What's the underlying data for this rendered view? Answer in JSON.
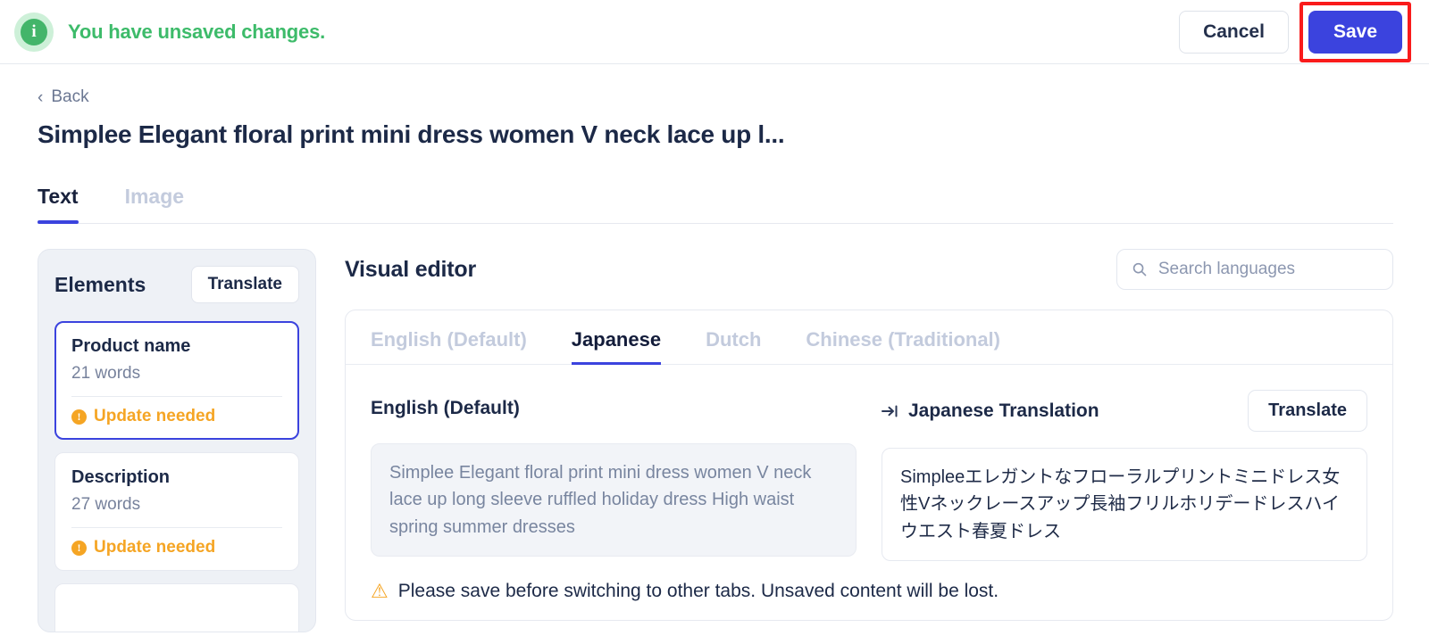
{
  "topbar": {
    "info_icon": "info-circle-icon",
    "message": "You have unsaved changes.",
    "cancel_label": "Cancel",
    "save_label": "Save",
    "save_button_color": "#3b43de",
    "message_color": "#3dbb6a",
    "highlight_color": "#f91b1b"
  },
  "page": {
    "back_label": "Back",
    "back_chevron": "‹",
    "title": "Simplee Elegant floral print mini dress women V neck lace up l..."
  },
  "main_tabs": [
    {
      "label": "Text",
      "active": true
    },
    {
      "label": "Image",
      "active": false
    }
  ],
  "sidebar": {
    "title": "Elements",
    "translate_label": "Translate",
    "items": [
      {
        "name": "Product name",
        "words": "21 words",
        "status": "Update needed",
        "status_icon": "exclamation-circle-icon",
        "selected": true
      },
      {
        "name": "Description",
        "words": "27 words",
        "status": "Update needed",
        "status_icon": "exclamation-circle-icon",
        "selected": false
      }
    ]
  },
  "editor": {
    "title": "Visual editor",
    "search": {
      "placeholder": "Search languages",
      "value": "",
      "icon": "search-icon"
    },
    "language_tabs": [
      {
        "label": "English (Default)",
        "active": false
      },
      {
        "label": "Japanese",
        "active": true
      },
      {
        "label": "Dutch",
        "active": false
      },
      {
        "label": "Chinese (Traditional)",
        "active": false
      }
    ],
    "source": {
      "label": "English (Default)",
      "text": "Simplee Elegant floral print mini dress women V neck lace up long sleeve ruffled holiday dress High waist spring summer dresses"
    },
    "target": {
      "label": "Japanese Translation",
      "arrow_icon": "arrow-right-to-bar-icon",
      "translate_label": "Translate",
      "text": "Simpleeエレガントなフローラルプリントミニドレス女性Vネックレースアップ長袖フリルホリデードレスハイウエスト春夏ドレス"
    },
    "warning": {
      "icon": "warning-triangle-icon",
      "text": "Please save before switching to other tabs. Unsaved content will be lost."
    }
  }
}
